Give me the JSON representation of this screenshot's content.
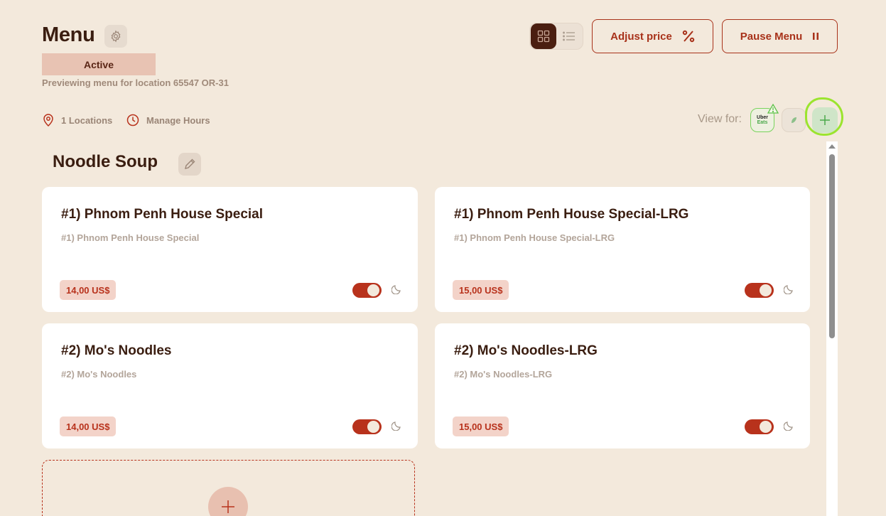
{
  "header": {
    "title": "Menu",
    "status": "Active",
    "preview_text": "Previewing menu for location 65547 OR-31"
  },
  "toolbar": {
    "adjust_price_label": "Adjust price",
    "pause_menu_label": "Pause Menu"
  },
  "meta": {
    "locations_label": "1 Locations",
    "hours_label": "Manage Hours",
    "view_for_label": "View for:"
  },
  "platforms": {
    "uber_line1": "Uber",
    "uber_line2": "Eats"
  },
  "category": {
    "title": "Noodle Soup",
    "items": [
      {
        "name": "#1) Phnom Penh House Special",
        "description": "#1) Phnom Penh House Special",
        "price": "14,00 US$"
      },
      {
        "name": "#1) Phnom Penh House Special-LRG",
        "description": "#1) Phnom Penh House Special-LRG",
        "price": "15,00 US$"
      },
      {
        "name": "#2) Mo's Noodles",
        "description": "#2) Mo's Noodles",
        "price": "14,00 US$"
      },
      {
        "name": "#2) Mo's Noodles-LRG",
        "description": "#2) Mo's Noodles-LRG",
        "price": "15,00 US$"
      }
    ]
  },
  "colors": {
    "background": "#f3e9dc",
    "accent": "#b8321c",
    "dark": "#3a1d10",
    "highlight": "#9be42f"
  }
}
